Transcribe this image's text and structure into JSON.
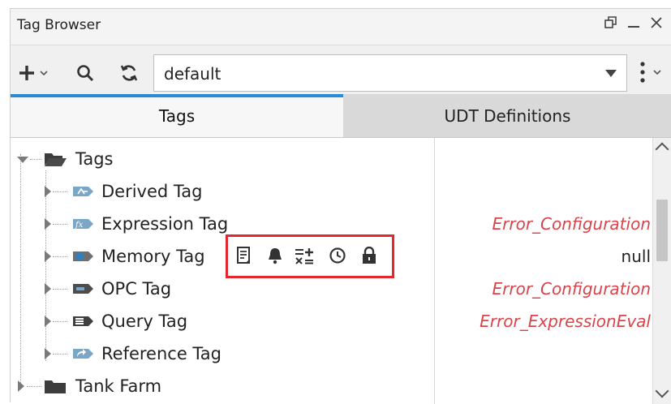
{
  "window": {
    "title": "Tag Browser"
  },
  "toolbar": {
    "add_icon": "plus-icon",
    "search_icon": "search-icon",
    "refresh_icon": "refresh-icon",
    "provider_value": "default",
    "menu_icon": "kebab-menu-icon"
  },
  "tabs": [
    {
      "label": "Tags",
      "active": true
    },
    {
      "label": "UDT Definitions",
      "active": false
    }
  ],
  "tree": {
    "root_label": "Tags",
    "items": [
      {
        "label": "Derived Tag",
        "icon": "derived-tag-icon",
        "value": ""
      },
      {
        "label": "Expression Tag",
        "icon": "expression-tag-icon",
        "value": "Error_Configuration"
      },
      {
        "label": "Memory Tag",
        "icon": "memory-tag-icon",
        "value": "null"
      },
      {
        "label": "OPC Tag",
        "icon": "opc-tag-icon",
        "value": "Error_Configuration"
      },
      {
        "label": "Query Tag",
        "icon": "query-tag-icon",
        "value": "Error_ExpressionEval"
      },
      {
        "label": "Reference Tag",
        "icon": "reference-tag-icon",
        "value": ""
      }
    ],
    "folder_label": "Tank Farm"
  },
  "memory_tag_state_icons": [
    "documentation-icon",
    "alarm-bell-icon",
    "scaling-icon",
    "history-clock-icon",
    "security-lock-icon"
  ],
  "colors": {
    "accent": "#2b8ad6",
    "error": "#d9434a",
    "highlight": "#e0282e"
  }
}
